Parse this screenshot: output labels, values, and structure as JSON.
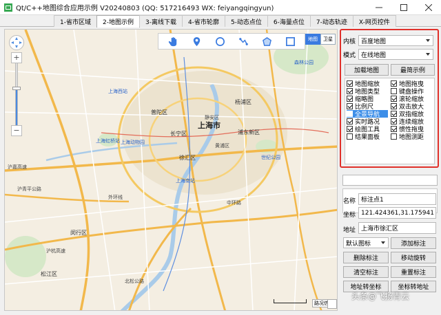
{
  "window": {
    "title": "Qt/C++地图综合应用示例 V20240803 (QQ: 517216493 WX: feiyangqingyun)"
  },
  "tabs": [
    {
      "label": "1-省市区域",
      "active": false
    },
    {
      "label": "2-地图示例",
      "active": true
    },
    {
      "label": "3-离线下载",
      "active": false
    },
    {
      "label": "4-省市轮廓",
      "active": false
    },
    {
      "label": "5-动态点位",
      "active": false
    },
    {
      "label": "6-海量点位",
      "active": false
    },
    {
      "label": "7-动态轨迹",
      "active": false
    },
    {
      "label": "X-网页控件",
      "active": false
    }
  ],
  "map": {
    "type_buttons": [
      "地图",
      "卫星"
    ],
    "active_type": "地图",
    "tools": [
      "hand-icon",
      "marker-icon",
      "circle-icon",
      "polyline-icon",
      "polygon-icon",
      "rectangle-icon"
    ],
    "zoom_level_fraction": 0.6,
    "copyright": "路况信息",
    "labels": {
      "city": "上海市",
      "d1": "浦东新区",
      "d2": "长宁区",
      "d3": "徐汇区",
      "d4": "闵行区",
      "d5": "普陀区",
      "d6": "杨浦区",
      "d7": "松江区",
      "d8": "静安区",
      "d9": "黄浦区",
      "r1": "沪嘉高速",
      "r2": "沪青平公路",
      "r3": "中环路",
      "r4": "外环线",
      "r5": "北松公路",
      "r6": "沪杭高速",
      "p1": "上海虹桥站",
      "p2": "上海南站",
      "p3": "上海西站",
      "p4": "上海动物园",
      "p5": "世纪公园",
      "p6": "森林公园"
    }
  },
  "panel": {
    "kernel_label": "内核",
    "kernel_value": "百度地图",
    "mode_label": "模式",
    "mode_value": "在线地图",
    "load_button": "加载地图",
    "simple_button": "最简示例",
    "checks_left": [
      {
        "label": "地图缩放",
        "checked": true,
        "selected": false
      },
      {
        "label": "地图类型",
        "checked": true,
        "selected": false
      },
      {
        "label": "缩略图",
        "checked": true,
        "selected": false
      },
      {
        "label": "比例尺",
        "checked": true,
        "selected": false
      },
      {
        "label": "全景导航",
        "checked": false,
        "selected": true
      },
      {
        "label": "实时路况",
        "checked": true,
        "selected": false
      },
      {
        "label": "绘图工具",
        "checked": true,
        "selected": false
      },
      {
        "label": "结果面板",
        "checked": false,
        "selected": false
      }
    ],
    "checks_right": [
      {
        "label": "地图拖曳",
        "checked": true
      },
      {
        "label": "键盘操作",
        "checked": false
      },
      {
        "label": "滚轮缩放",
        "checked": true
      },
      {
        "label": "双击放大",
        "checked": true
      },
      {
        "label": "双指缩放",
        "checked": true
      },
      {
        "label": "连续缩放",
        "checked": true
      },
      {
        "label": "惯性拖曳",
        "checked": true
      },
      {
        "label": "地图测距",
        "checked": false
      }
    ],
    "name_label": "名称",
    "name_value": "标注点1",
    "coord_label": "坐标",
    "coord_value": "121.424361,31.175941",
    "address_label": "地址",
    "address_value": "上海市徐汇区",
    "icon_select": "默认图标",
    "add_marker": "添加标注",
    "delete_marker": "删除标注",
    "move_rotate": "移动旋转",
    "clear_marker": "清空标注",
    "reset_marker": "重置标注",
    "addr_to_coord": "地址转坐标",
    "coord_to_addr": "坐标转地址"
  },
  "watermark": "头条@飞扬青云"
}
